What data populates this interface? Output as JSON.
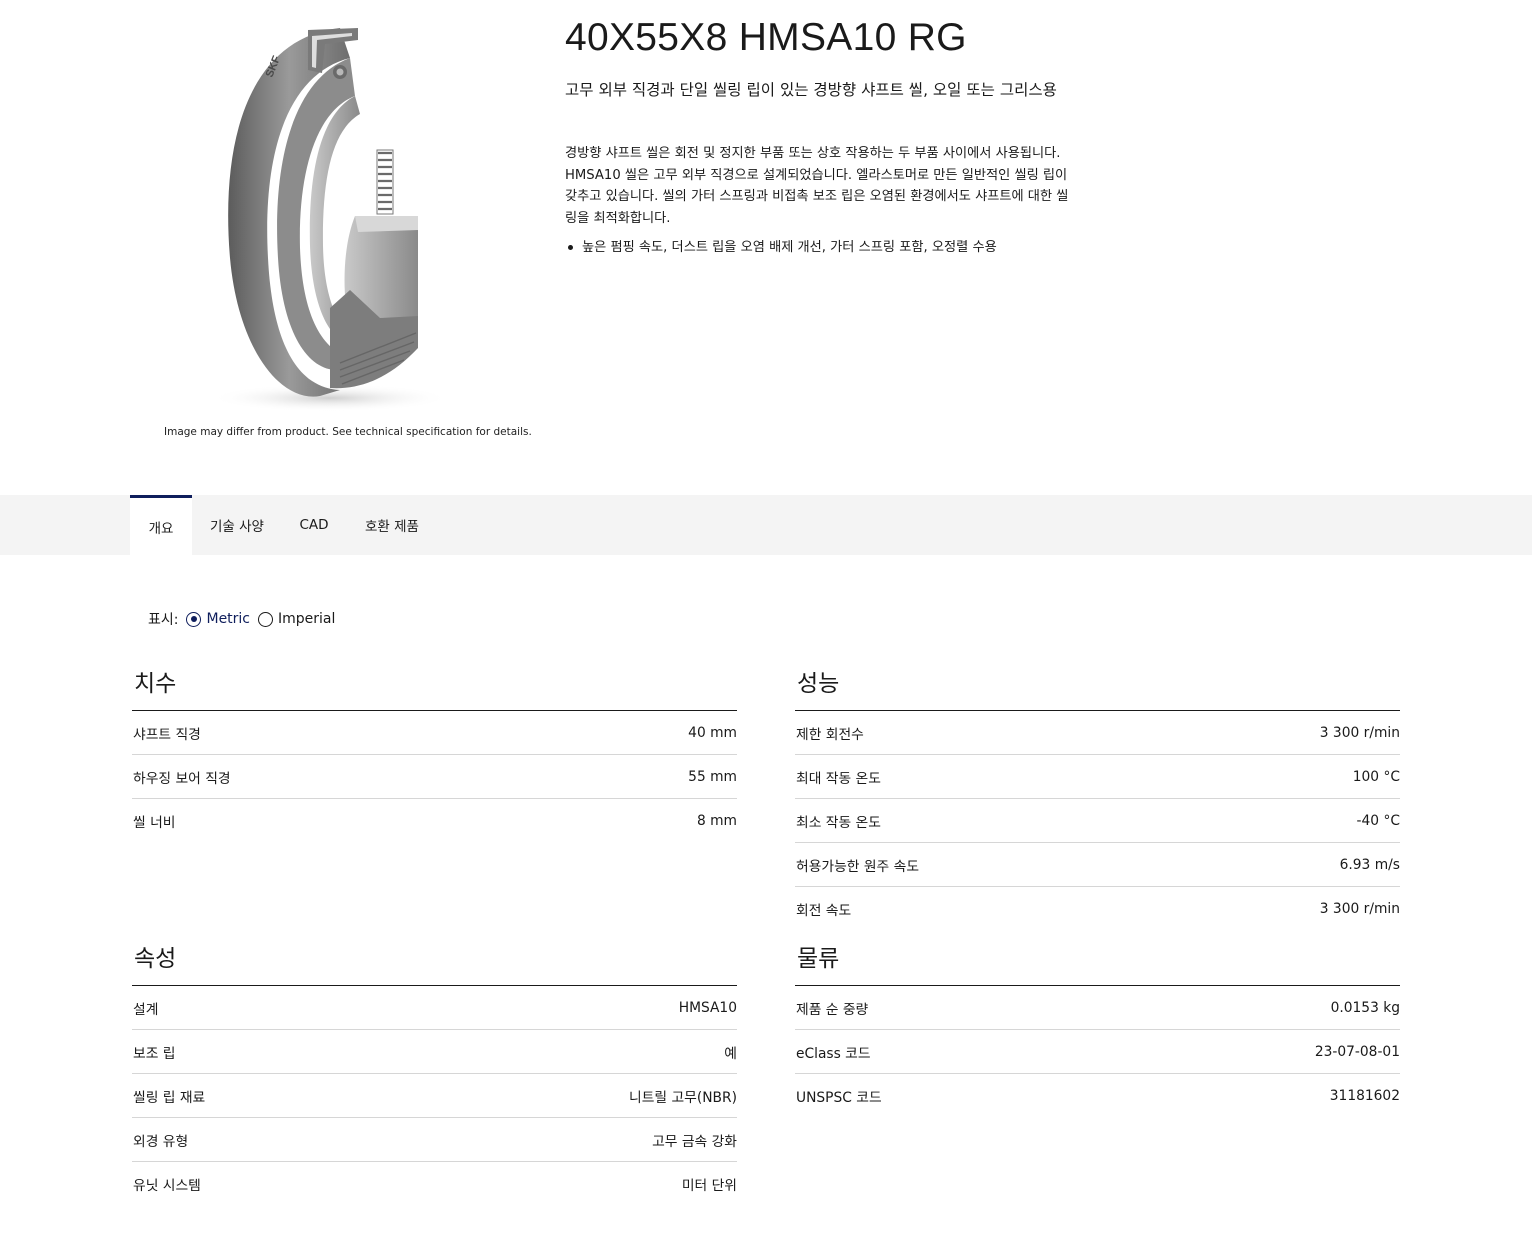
{
  "product": {
    "title": "40X55X8 HMSA10 RG",
    "subtitle": "고무 외부 직경과 단일 씰링 립이 있는 경방향 샤프트 씰, 오일 또는 그리스용",
    "description": "경방향 샤프트 씰은 회전 및 정지한 부품 또는 상호 작용하는 두 부품 사이에서 사용됩니다. HMSA10 씰은 고무 외부 직경으로 설계되었습니다. 엘라스토머로 만든 일반적인 씰링 립이 갖추고 있습니다. 씰의 가터 스프링과 비접촉 보조 립은 오염된 환경에서도 샤프트에 대한 씰링을 최적화합니다.",
    "bullets": [
      "높은 펌핑 속도, 더스트 립을 오염 배제 개선, 가터 스프링 포함, 오정렬 수용"
    ],
    "image_caption": "Image may differ from product. See technical specification for details.",
    "image_brand": "SKF"
  },
  "tabs": [
    {
      "label": "개요",
      "active": true
    },
    {
      "label": "기술 사양",
      "active": false
    },
    {
      "label": "CAD",
      "active": false
    },
    {
      "label": "호환 제품",
      "active": false
    }
  ],
  "units": {
    "label": "표시:",
    "options": [
      {
        "label": "Metric",
        "selected": true
      },
      {
        "label": "Imperial",
        "selected": false
      }
    ]
  },
  "sections": {
    "dimensions": {
      "heading": "치수",
      "rows": [
        {
          "label": "샤프트 직경",
          "value": "40 mm"
        },
        {
          "label": "하우징 보어 직경",
          "value": "55 mm"
        },
        {
          "label": "씰 너비",
          "value": "8 mm"
        }
      ]
    },
    "performance": {
      "heading": "성능",
      "rows": [
        {
          "label": "제한 회전수",
          "value": "3 300 r/min"
        },
        {
          "label": "최대 작동 온도",
          "value": "100 °C"
        },
        {
          "label": "최소 작동 온도",
          "value": "-40 °C"
        },
        {
          "label": "허용가능한 원주 속도",
          "value": "6.93 m/s"
        },
        {
          "label": "회전 속도",
          "value": "3 300 r/min"
        }
      ]
    },
    "attributes": {
      "heading": "속성",
      "rows": [
        {
          "label": "설계",
          "value": "HMSA10"
        },
        {
          "label": "보조 립",
          "value": "예"
        },
        {
          "label": "씰링 립 재료",
          "value": "니트릴 고무(NBR)"
        },
        {
          "label": "외경 유형",
          "value": "고무 금속 강화"
        },
        {
          "label": "유닛 시스템",
          "value": "미터 단위"
        }
      ]
    },
    "logistics": {
      "heading": "물류",
      "rows": [
        {
          "label": "제품 순 중량",
          "value": "0.0153 kg"
        },
        {
          "label": "eClass 코드",
          "value": "23-07-08-01"
        },
        {
          "label": "UNSPSC 코드",
          "value": "31181602"
        }
      ]
    }
  },
  "colors": {
    "accent": "#0f1e5c",
    "tabbar_bg": "#f4f4f4",
    "text": "#1a1a1a",
    "divider": "#d6d6d6"
  }
}
